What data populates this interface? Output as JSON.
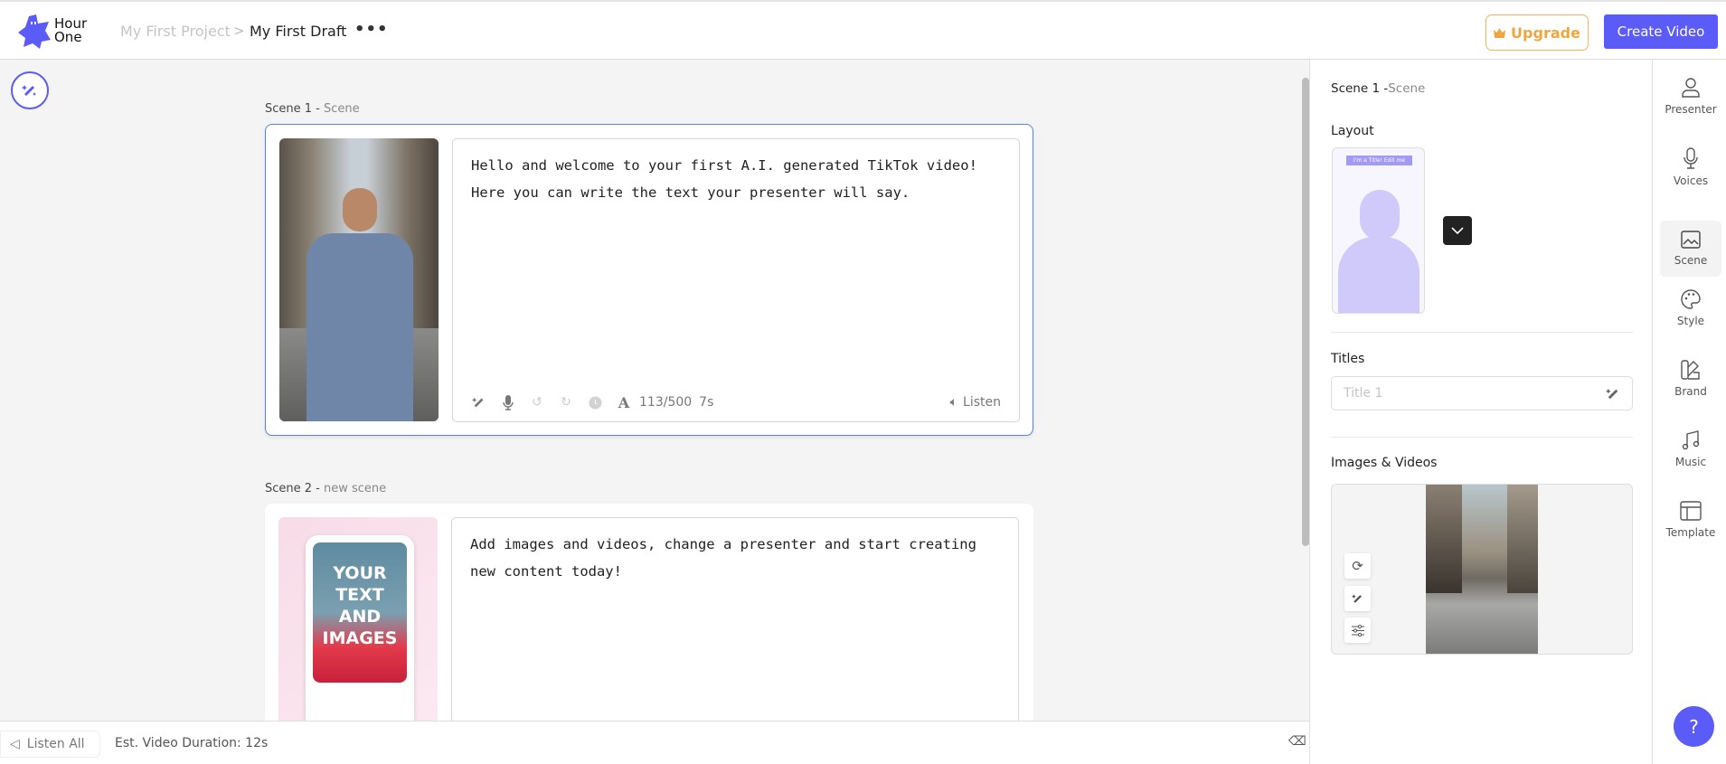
{
  "header": {
    "logo_text_1": "Hour",
    "logo_text_2": "One",
    "breadcrumb": {
      "project": "My First Project",
      "separator": ">",
      "draft": "My First Draft"
    },
    "more_label": "•••",
    "upgrade_label": "Upgrade",
    "create_label": "Create Video"
  },
  "colors": {
    "accent": "#5b5bf7",
    "upgrade": "#f0a640",
    "active_border": "#5b82d6"
  },
  "scenes": [
    {
      "number": "Scene 1 - ",
      "name": "Scene",
      "text": "Hello and welcome to your first A.I. generated TikTok video!\nHere you can write the text your presenter will say.",
      "count": "113/500",
      "duration": "7s",
      "listen": "Listen"
    },
    {
      "number": "Scene 2 - ",
      "name": "new scene",
      "text": "Add images and videos, change a presenter and start creating\nnew content today!",
      "thumb_text": "YOUR TEXT AND IMAGES"
    }
  ],
  "bottom": {
    "listen_all": "Listen All",
    "duration": "Est. Video Duration: 12s"
  },
  "panel": {
    "title": "Scene 1 -",
    "title_sub": "Scene",
    "layout_label": "Layout",
    "layout_thumb_title": "I'm a Title! Edit me",
    "titles_label": "Titles",
    "title_placeholder": "Title 1",
    "media_label": "Images & Videos"
  },
  "rail": [
    {
      "label": "Presenter",
      "icon": "person-icon"
    },
    {
      "label": "Voices",
      "icon": "microphone-icon"
    },
    {
      "label": "Scene",
      "icon": "image-icon",
      "active": true
    },
    {
      "label": "Style",
      "icon": "palette-icon"
    },
    {
      "label": "Brand",
      "icon": "swatch-icon"
    },
    {
      "label": "Music",
      "icon": "music-icon"
    },
    {
      "label": "Template",
      "icon": "template-icon"
    }
  ],
  "help_label": "?"
}
